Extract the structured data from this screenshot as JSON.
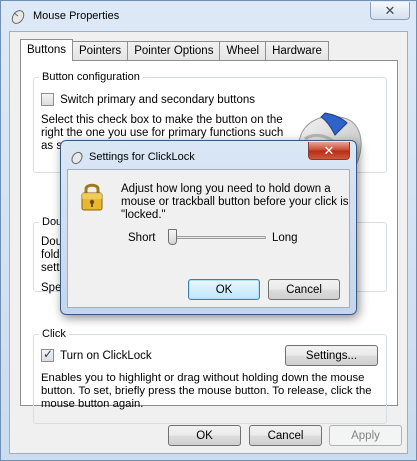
{
  "window": {
    "title": "Mouse Properties",
    "close_glyph": "✕"
  },
  "tabs": [
    {
      "label": "Buttons"
    },
    {
      "label": "Pointers"
    },
    {
      "label": "Pointer Options"
    },
    {
      "label": "Wheel"
    },
    {
      "label": "Hardware"
    }
  ],
  "button_config": {
    "legend": "Button configuration",
    "switch_label": "Switch primary and secondary buttons",
    "desc_line1": "Select this check box to make the button on the",
    "desc_line2": "right the one you use for primary functions such",
    "desc_line3": "as s"
  },
  "double_click": {
    "legend": "Dou",
    "line1": "Dou",
    "line2": "folde",
    "line3": "setti",
    "speed": "Spe"
  },
  "clicklock": {
    "legend": "Click",
    "checkbox_label": "Turn on ClickLock",
    "checked": true,
    "settings_button": "Settings...",
    "desc_line1": "Enables you to highlight or drag without holding down the mouse",
    "desc_line2": "button. To set, briefly press the mouse button. To release, click the",
    "desc_line3": "mouse button again."
  },
  "footer": {
    "ok": "OK",
    "cancel": "Cancel",
    "apply": "Apply"
  },
  "dialog": {
    "title": "Settings for ClickLock",
    "close_glyph": "✕",
    "message_line1": "Adjust how long you need to hold down a",
    "message_line2": "mouse or trackball button before your click is",
    "message_line3": "\"locked.\"",
    "slider_min_label": "Short",
    "slider_max_label": "Long",
    "slider_level": 0.0,
    "ok": "OK",
    "cancel": "Cancel"
  },
  "colors": {
    "title_bar": "#cbdcef",
    "close_red": "#c7442d",
    "default_button": "#bee6fd"
  },
  "icons": {
    "window": "mouse-icon",
    "dialog": "mouse-icon",
    "lock": "padlock-icon",
    "illustration": "mouse-illustration"
  }
}
